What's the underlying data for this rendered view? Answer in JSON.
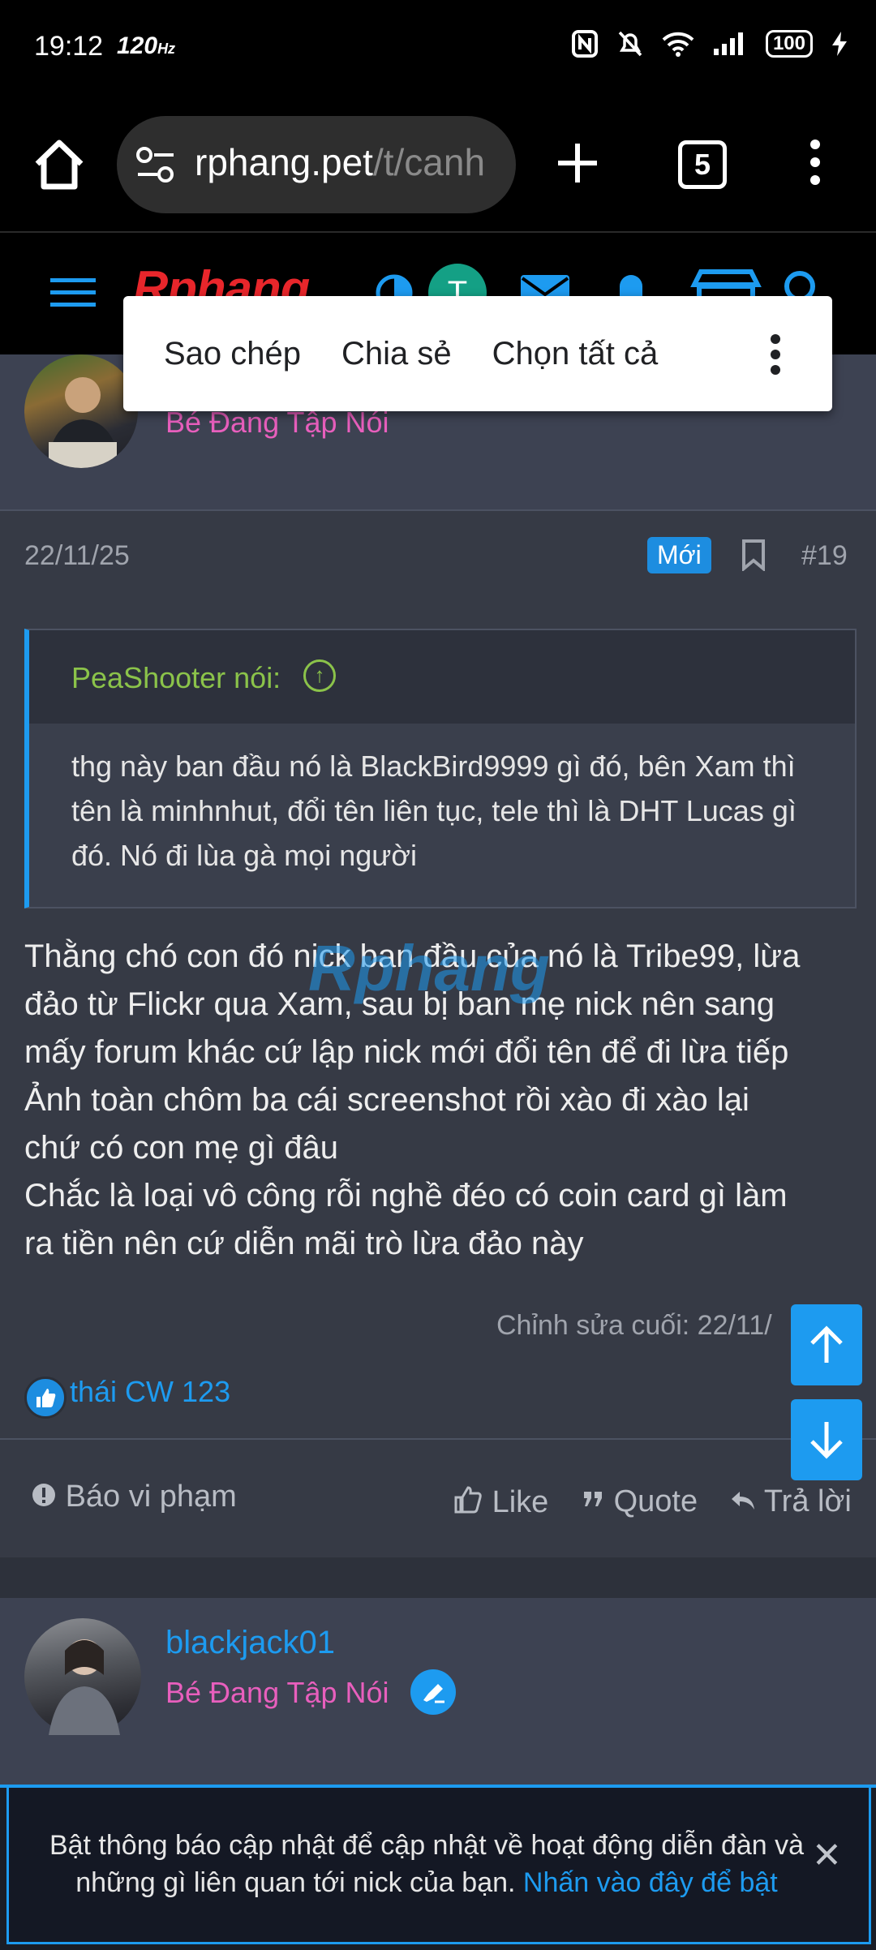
{
  "status_bar": {
    "time": "19:12",
    "refresh_rate": "120",
    "refresh_unit": "Hz",
    "battery": "100"
  },
  "browser": {
    "url_domain": "rphang.pet",
    "url_path": "/t/canh",
    "tab_count": "5"
  },
  "site": {
    "logo_text": "Rphang",
    "avatar_letter": "T"
  },
  "context_menu": {
    "copy": "Sao chép",
    "share": "Chia sẻ",
    "select_all": "Chọn tất cả"
  },
  "post": {
    "author_role": "Bé Đang Tập Nói",
    "date": "22/11/25",
    "new_badge": "Mới",
    "number": "#19",
    "quote": {
      "author": "PeaShooter nói:",
      "text": "thg này ban đầu nó là BlackBird9999 gì đó, bên Xam thì tên là minhnhut, đổi tên liên tục, tele thì là DHT Lucas gì đó. Nó đi lùa gà mọi người"
    },
    "body_lines": [
      "Thằng chó con đó nick ban đầu của nó là Tribe99, lừa",
      "đảo từ Flickr qua Xam, sau bị ban mẹ nick nên sang",
      "mấy forum khác cứ lập nick mới đổi tên để đi lừa tiếp",
      "Ảnh toàn chôm ba cái screenshot rồi xào đi xào lại",
      "chứ có con mẹ gì đâu",
      "Chắc là loại vô công rỗi nghề đéo có coin card gì làm",
      "ra tiền nên cứ diễn mãi trò lừa đảo này"
    ],
    "watermark": "Rphang",
    "edit_note": "Chỉnh sửa cuối: 22/11/",
    "liker": "thái CW 123",
    "actions": {
      "report": "Báo vi phạm",
      "like": "Like",
      "quote": "Quote",
      "reply": "Trả lời"
    }
  },
  "next_post": {
    "username": "blackjack01",
    "role": "Bé Đang Tập Nói"
  },
  "notification": {
    "text": "Bật thông báo cập nhật để cập nhật về hoạt động diễn đàn và những gì liên quan tới nick của bạn.",
    "link": "Nhấn vào đây để bật"
  },
  "colors": {
    "accent": "#1d9bf0",
    "role_pink": "#e85fbd",
    "quote_green": "#8bc34a",
    "logo_red": "#e8262b"
  }
}
